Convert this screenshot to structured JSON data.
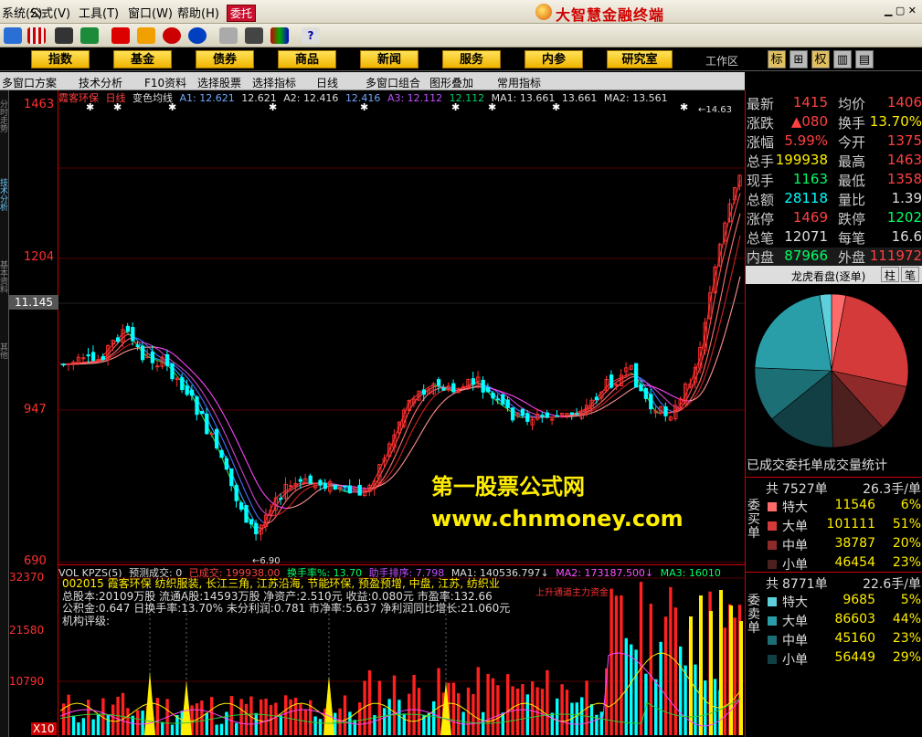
{
  "menu": {
    "items": [
      "系统(S)",
      "公式(V)",
      "工具(T)",
      "窗口(W)",
      "帮助(H)"
    ],
    "weituo": "委托",
    "app_title": "大智慧金融终端"
  },
  "nav": {
    "buttons": [
      "指数",
      "基金",
      "债券",
      "商品",
      "新闻",
      "服务",
      "内参",
      "研究室"
    ],
    "workspace": "工作区",
    "view_tabs": [
      "标",
      "⊞",
      "权",
      "▥",
      "▤"
    ]
  },
  "subbar": {
    "items": [
      "多窗口方案",
      "技术分析",
      "F10资料",
      "选择股票",
      "选择指标",
      "日线",
      "多窗口组合",
      "图形叠加",
      "常用指标"
    ]
  },
  "lefttabs": [
    "分时走势",
    "技术分析",
    "基本资料",
    "其他"
  ],
  "axis": {
    "labels": [
      "1463",
      "1204",
      "947",
      "690"
    ],
    "crosshair": "11.145",
    "vol_labels": [
      "32370",
      "21580",
      "10790",
      "X10"
    ]
  },
  "chart_head": {
    "stock": "霞客环保",
    "period": "日线",
    "indicator": "变色均线",
    "a1": "A1: 12.621",
    "a1b": "12.621",
    "a2": "A2: 12.416",
    "a2b": "12.416",
    "a3": "A3: 12.112",
    "a3b": "12.112",
    "ma1": "MA1: 13.661",
    "ma1b": "13.661",
    "ma2": "MA2: 13.561"
  },
  "chart_marks": {
    "high": "14.63",
    "low": "6.90"
  },
  "watermark": {
    "line1": "第一股票公式网",
    "line2": "www.chnmoney.com"
  },
  "vol_head": {
    "name": "VOL KPZS(5)",
    "v1": "预测成交: 0",
    "v2": "已成交: 199938.00",
    "v3": "换手率%: 13.70",
    "v4": "助手排序: 7.798",
    "v5": "MA1: 140536.797↓",
    "v6": "MA2: 173187.500↓",
    "v7": "MA3: 16010"
  },
  "info": {
    "row1": "002015  霞客环保 纺织服装, 长江三角, 江苏沿海, 节能环保, 预盈预增, 中盘, 江苏, 纺织业",
    "row2": "总股本:20109万股 流通A股:14593万股  净资产:2.510元  收益:0.080元  市盈率:132.66",
    "row3": "公积金:0.647  日换手率:13.70%  未分利润:0.781  市净率:5.637  净利润同比增长:21.060元",
    "row4": "机构评级:",
    "red_note": "上升通道主力资金"
  },
  "quote": [
    {
      "l": "最新",
      "v": "1415",
      "vc": "#ff4040",
      "l2": "均价",
      "v2": "1406",
      "v2c": "#ff4040"
    },
    {
      "l": "涨跌",
      "v": "▲080",
      "vc": "#ff4040",
      "l2": "换手",
      "v2": "13.70%",
      "v2c": "#ffee00"
    },
    {
      "l": "涨幅",
      "v": "5.99%",
      "vc": "#ff4040",
      "l2": "今开",
      "v2": "1375",
      "v2c": "#ff4040"
    },
    {
      "l": "总手",
      "v": "199938",
      "vc": "#ffee00",
      "l2": "最高",
      "v2": "1463",
      "v2c": "#ff4040"
    },
    {
      "l": "现手",
      "v": "1163",
      "vc": "#00ff66",
      "l2": "最低",
      "v2": "1358",
      "v2c": "#ff4040"
    },
    {
      "l": "总额",
      "v": "28118",
      "vc": "#00ffff",
      "l2": "量比",
      "v2": "1.39",
      "v2c": "#dddddd"
    },
    {
      "l": "涨停",
      "v": "1469",
      "vc": "#ff4040",
      "l2": "跌停",
      "v2": "1202",
      "v2c": "#00ff66"
    },
    {
      "l": "总笔",
      "v": "12071",
      "vc": "#dddddd",
      "l2": "每笔",
      "v2": "16.6",
      "v2c": "#dddddd"
    },
    {
      "l": "内盘",
      "v": "87966",
      "vc": "#00ff66",
      "l2": "外盘",
      "v2": "111972",
      "v2c": "#ff4040"
    }
  ],
  "pie": {
    "title": "龙虎看盘(逐单)",
    "btn1": "柱",
    "btn2": "笔",
    "stat_title": "已成交委托单成交量统计"
  },
  "buy": {
    "side": "委买单",
    "total_label": "共",
    "total": "7527单",
    "per": "26.3手/单",
    "rows": [
      {
        "l": "特大",
        "v": "11546",
        "p": "6%",
        "c": "#ff6b6b"
      },
      {
        "l": "大单",
        "v": "101111",
        "p": "51%",
        "c": "#d43a3a"
      },
      {
        "l": "中单",
        "v": "38787",
        "p": "20%",
        "c": "#8e2a2a"
      },
      {
        "l": "小单",
        "v": "46454",
        "p": "23%",
        "c": "#4d2020"
      }
    ]
  },
  "sell": {
    "side": "委卖单",
    "total_label": "共",
    "total": "8771单",
    "per": "22.6手/单",
    "rows": [
      {
        "l": "特大",
        "v": "9685",
        "p": "5%",
        "c": "#5ed0dc"
      },
      {
        "l": "大单",
        "v": "86603",
        "p": "44%",
        "c": "#2a9ea8"
      },
      {
        "l": "中单",
        "v": "45160",
        "p": "23%",
        "c": "#1d6f76"
      },
      {
        "l": "小单",
        "v": "56449",
        "p": "29%",
        "c": "#123f44"
      }
    ]
  }
}
